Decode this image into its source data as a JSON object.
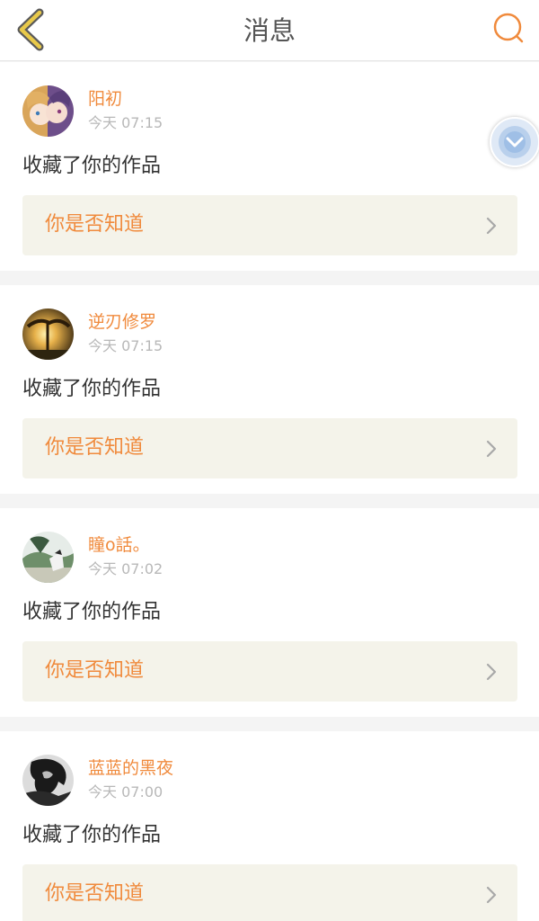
{
  "header": {
    "title": "消息",
    "back_icon": "chevron-left-icon",
    "chat_icon": "chat-bubble-icon",
    "accent_back": "#e8c94a",
    "accent_chat": "#f08a3c"
  },
  "colors": {
    "username": "#f08a3c",
    "time": "#b8b8b8",
    "action": "#333333",
    "work_box_bg": "#f4f3ea",
    "divider": "#f4f4f4"
  },
  "messages": [
    {
      "username": "阳初",
      "time": "今天 07:15",
      "action": "收藏了你的作品",
      "work_title": "你是否知道",
      "avatar_icon": "anime-girls-avatar"
    },
    {
      "username": "逆刃修罗",
      "time": "今天 07:15",
      "action": "收藏了你的作品",
      "work_title": "你是否知道",
      "avatar_icon": "sunset-tree-avatar"
    },
    {
      "username": "瞳o話。",
      "time": "今天 07:02",
      "action": "收藏了你的作品",
      "work_title": "你是否知道",
      "avatar_icon": "landscape-avatar"
    },
    {
      "username": "蓝蓝的黑夜",
      "time": "今天 07:00",
      "action": "收藏了你的作品",
      "work_title": "你是否知道",
      "avatar_icon": "silhouette-avatar"
    }
  ],
  "floating_button_icon": "floating-assist-icon"
}
